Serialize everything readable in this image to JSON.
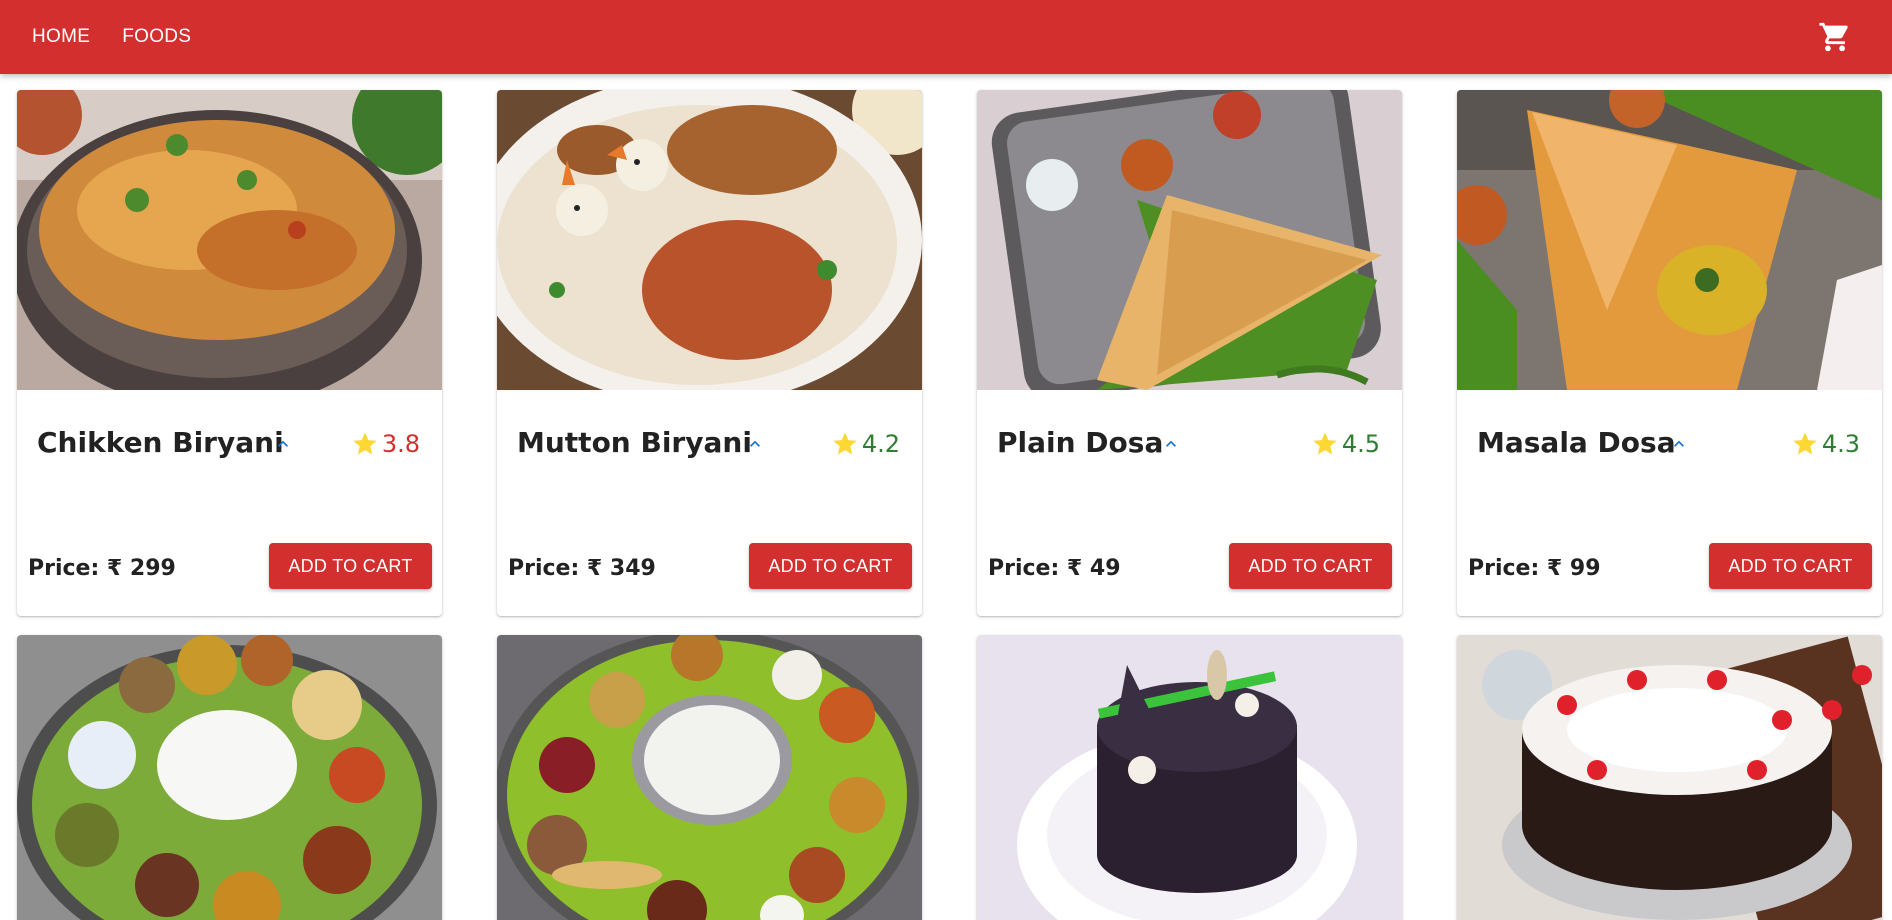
{
  "nav": {
    "home_label": "HOME",
    "foods_label": "FOODS"
  },
  "cart": {
    "icon": "shopping-cart-icon"
  },
  "colors": {
    "primary": "#d32f2f",
    "rating_low": "#d32f2f",
    "rating_high": "#2e7d32",
    "star": "#fdd835",
    "expand_icon": "#1976d2"
  },
  "items": [
    {
      "name": "Chikken Biryani",
      "rating": "3.8",
      "rating_color": "low",
      "price_label": "Price: ₹ 299",
      "button_label": "ADD TO CART",
      "image": "chicken-biryani-photo"
    },
    {
      "name": "Mutton Biryani",
      "rating": "4.2",
      "rating_color": "high",
      "price_label": "Price: ₹ 349",
      "button_label": "ADD TO CART",
      "image": "mutton-biryani-photo"
    },
    {
      "name": "Plain Dosa",
      "rating": "4.5",
      "rating_color": "high",
      "price_label": "Price: ₹ 49",
      "button_label": "ADD TO CART",
      "image": "plain-dosa-photo"
    },
    {
      "name": "Masala Dosa",
      "rating": "4.3",
      "rating_color": "high",
      "price_label": "Price: ₹ 99",
      "button_label": "ADD TO CART",
      "image": "masala-dosa-photo"
    },
    {
      "image": "south-indian-thali-photo"
    },
    {
      "image": "banana-leaf-thali-photo"
    },
    {
      "image": "chocolate-cake-photo"
    },
    {
      "image": "black-forest-cake-photo"
    }
  ]
}
